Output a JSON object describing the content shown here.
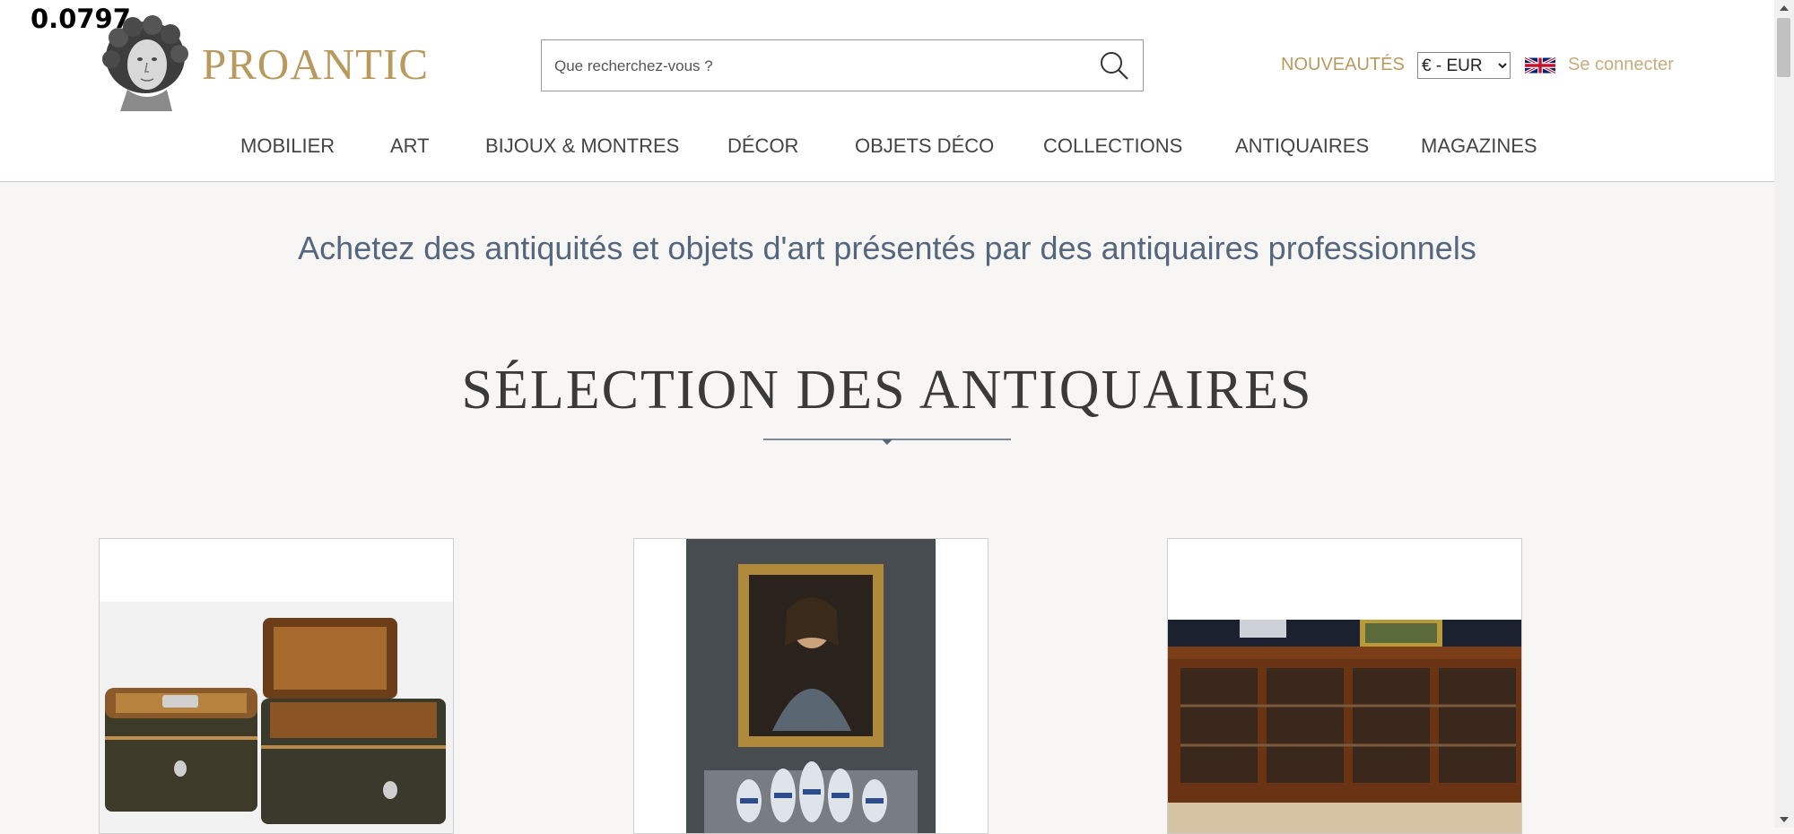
{
  "overlay_value": "0.0797",
  "brand": {
    "name": "PROANTIC",
    "color": "#b89a5e",
    "logo_icon": "classical-bust-logo"
  },
  "search": {
    "placeholder": "Que recherchez-vous ?",
    "value": "",
    "icon": "search-icon"
  },
  "header_links": {
    "new_label": "NOUVEAUTÉS",
    "currency_selected": "€ - EUR",
    "language_icon": "uk-flag-icon",
    "login_label": "Se connecter"
  },
  "nav": {
    "items": [
      {
        "label": "MOBILIER"
      },
      {
        "label": "ART"
      },
      {
        "label": "BIJOUX & MONTRES"
      },
      {
        "label": "DÉCOR"
      },
      {
        "label": "OBJETS DÉCO"
      },
      {
        "label": "COLLECTIONS"
      },
      {
        "label": "ANTIQUAIRES"
      },
      {
        "label": "MAGAZINES"
      }
    ]
  },
  "tagline": "Achetez des antiquités et objets d'art présentés par des antiquaires professionnels",
  "section": {
    "title": "SÉLECTION DES ANTIQUAIRES"
  },
  "cards": [
    {
      "subject": "marquetry-boxes-image"
    },
    {
      "subject": "portrait-painting-image"
    },
    {
      "subject": "glazed-cabinet-image"
    }
  ],
  "colors": {
    "accent_gold": "#b89a5e",
    "tagline_blue": "#55677d",
    "page_bg": "#f7f6f4"
  }
}
